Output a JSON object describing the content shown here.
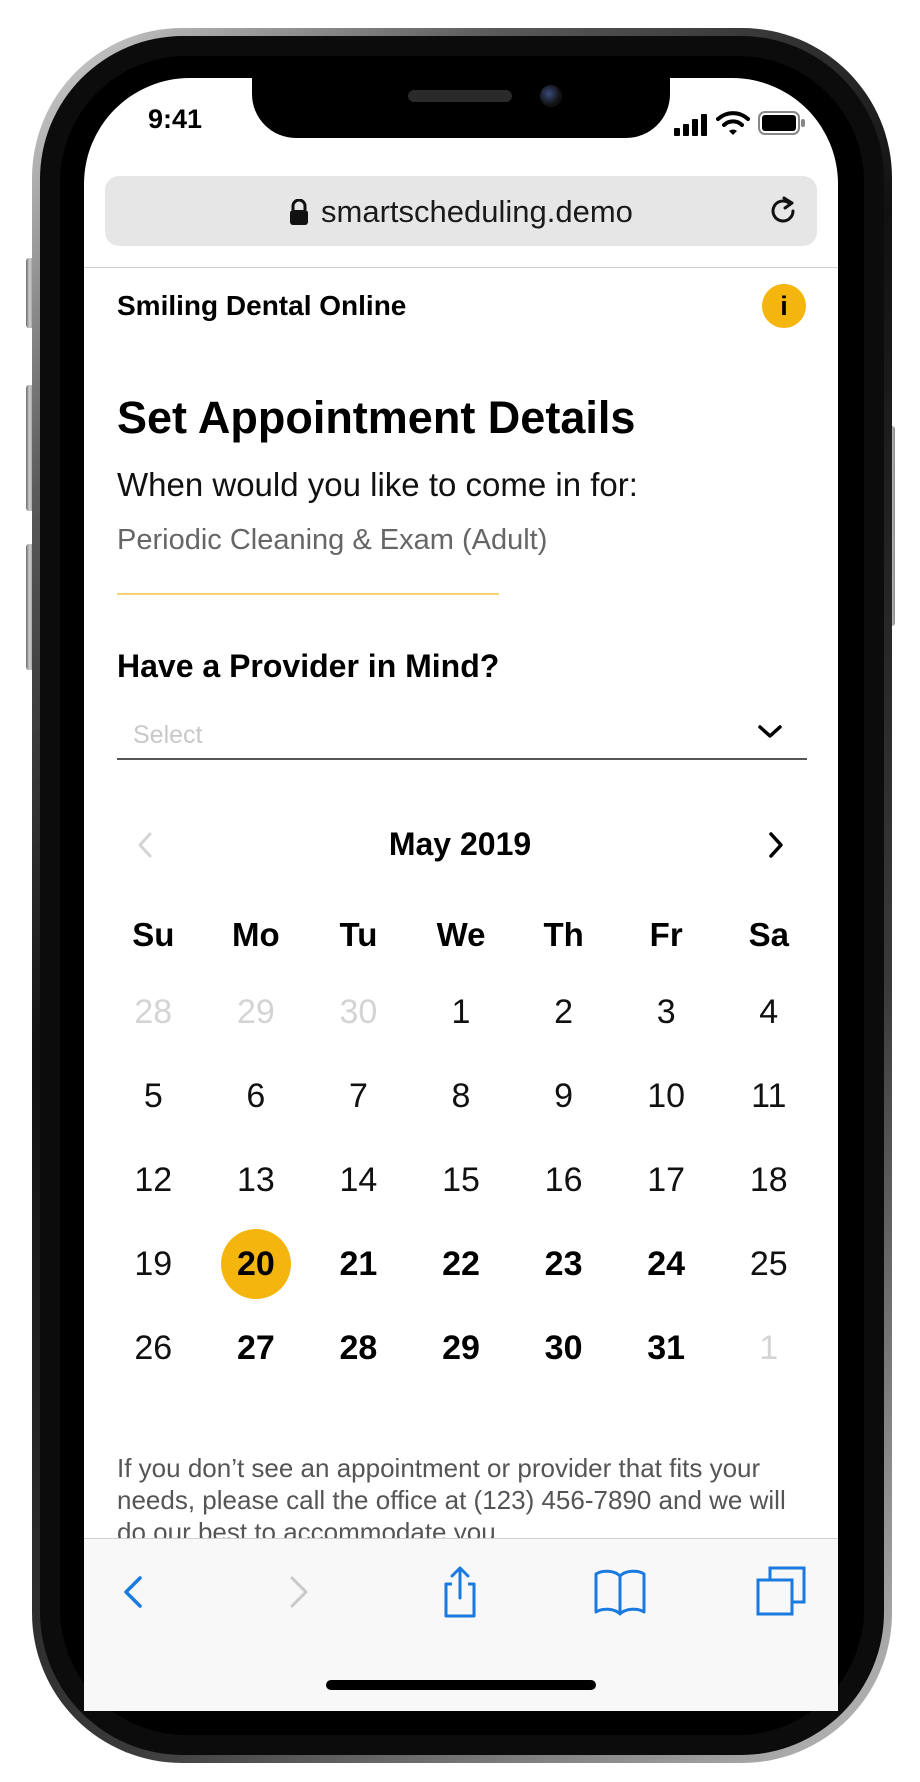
{
  "status_bar": {
    "time": "9:41"
  },
  "browser": {
    "url": "smartscheduling.demo"
  },
  "page": {
    "brand": "Smiling Dental Online",
    "info_label": "i",
    "title": "Set Appointment Details",
    "prompt": "When would you like to come in for:",
    "service": "Periodic Cleaning & Exam (Adult)",
    "provider_heading": "Have a Provider in Mind?",
    "provider_placeholder": "Select",
    "footer_note": "If you don’t see an appointment or provider that fits your needs, please call the office at (123) 456-7890 and we will do our best to accommodate you."
  },
  "calendar": {
    "month_label": "May 2019",
    "weekdays": [
      "Su",
      "Mo",
      "Tu",
      "We",
      "Th",
      "Fr",
      "Sa"
    ],
    "weeks": [
      [
        {
          "d": "28",
          "s": "muted"
        },
        {
          "d": "29",
          "s": "muted"
        },
        {
          "d": "30",
          "s": "muted"
        },
        {
          "d": "1",
          "s": ""
        },
        {
          "d": "2",
          "s": ""
        },
        {
          "d": "3",
          "s": ""
        },
        {
          "d": "4",
          "s": ""
        }
      ],
      [
        {
          "d": "5",
          "s": ""
        },
        {
          "d": "6",
          "s": ""
        },
        {
          "d": "7",
          "s": ""
        },
        {
          "d": "8",
          "s": ""
        },
        {
          "d": "9",
          "s": ""
        },
        {
          "d": "10",
          "s": ""
        },
        {
          "d": "11",
          "s": ""
        }
      ],
      [
        {
          "d": "12",
          "s": ""
        },
        {
          "d": "13",
          "s": ""
        },
        {
          "d": "14",
          "s": ""
        },
        {
          "d": "15",
          "s": ""
        },
        {
          "d": "16",
          "s": ""
        },
        {
          "d": "17",
          "s": ""
        },
        {
          "d": "18",
          "s": ""
        }
      ],
      [
        {
          "d": "19",
          "s": ""
        },
        {
          "d": "20",
          "s": "selected"
        },
        {
          "d": "21",
          "s": "avail"
        },
        {
          "d": "22",
          "s": "avail"
        },
        {
          "d": "23",
          "s": "avail"
        },
        {
          "d": "24",
          "s": "avail"
        },
        {
          "d": "25",
          "s": ""
        }
      ],
      [
        {
          "d": "26",
          "s": ""
        },
        {
          "d": "27",
          "s": "avail"
        },
        {
          "d": "28",
          "s": "avail"
        },
        {
          "d": "29",
          "s": "avail"
        },
        {
          "d": "30",
          "s": "avail"
        },
        {
          "d": "31",
          "s": "avail"
        },
        {
          "d": "1",
          "s": "muted"
        }
      ]
    ]
  },
  "colors": {
    "accent": "#f4b50e",
    "ios_blue": "#1a7ae0"
  },
  "icons": {
    "lock": "lock-icon",
    "reload": "reload-icon",
    "info": "info-icon",
    "chevron_down": "chevron-down-icon",
    "prev_month": "chevron-left-icon",
    "next_month": "chevron-right-icon",
    "back": "back-icon",
    "forward": "forward-icon",
    "share": "share-icon",
    "bookmarks": "bookmarks-icon",
    "tabs": "tabs-icon"
  }
}
